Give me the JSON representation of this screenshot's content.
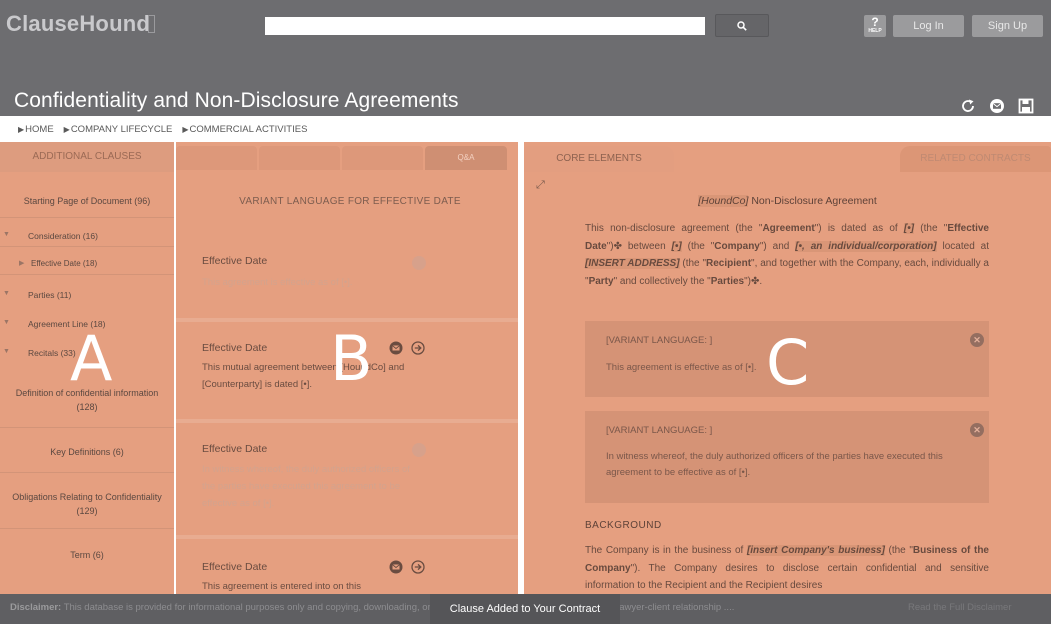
{
  "header": {
    "logo_text": "ClauseHound",
    "search": {
      "placeholder": "",
      "button_icon": "search-icon"
    },
    "help": {
      "mark": "?",
      "label": "HELP"
    },
    "login_label": "Log In",
    "signup_label": "Sign Up",
    "page_title": "Confidentiality and Non-Disclosure Agreements",
    "title_tools": [
      "refresh-icon",
      "email-icon",
      "save-icon"
    ]
  },
  "breadcrumb": [
    "HOME",
    "COMPANY LIFECYCLE",
    "COMMERCIAL ACTIVITIES"
  ],
  "panel_a": {
    "header": "ADDITIONAL CLAUSES",
    "items": [
      {
        "label": "Starting Page of Document (96)"
      },
      {
        "label": "Consideration (16)"
      },
      {
        "label": "Effective Date (18)"
      },
      {
        "label": "Parties (11)"
      },
      {
        "label": "Agreement Line (18)"
      },
      {
        "label": "Recitals (33)"
      },
      {
        "label": "Definition of confidential information (128)"
      },
      {
        "label": "Key Definitions (6)"
      },
      {
        "label": "Obligations Relating to Confidentiality (129)"
      },
      {
        "label": "Term (6)"
      }
    ],
    "overlay_letter": "A"
  },
  "panel_b": {
    "tabs": [
      "",
      "",
      "",
      "Q&A"
    ],
    "heading": "VARIANT LANGUAGE FOR EFFECTIVE DATE",
    "variants": [
      {
        "title": "Effective Date",
        "text": "This agreement is effective as of [•]."
      },
      {
        "title": "Effective Date",
        "text": "This mutual agreement between [HoundCo] and [Counterparty] is dated [•]."
      },
      {
        "title": "Effective Date",
        "text": "In witness whereof, the duly authorized officers of the parties have executed this agreement to be effective as of [•]."
      },
      {
        "title": "Effective Date",
        "text": "This agreement is entered into on this"
      }
    ],
    "overlay_letter": "B"
  },
  "panel_c": {
    "tab_core": "CORE ELEMENTS",
    "tab_related": "RELATED CONTRACTS",
    "doc_title_placeholder": "[HoundCo]",
    "doc_title_rest": " Non-Disclosure Agreement",
    "intro_paragraph": {
      "p1": "This non-disclosure agreement (the \"",
      "agreement": "Agreement",
      "p2": "\") is dated as of ",
      "date_ph": "[•]",
      "p3": " (the \"",
      "effective": "Effective Date",
      "p4": "\")✤ between ",
      "company_ph": "[•]",
      "p5": " (the \"",
      "company": "Company",
      "p6": "\") and ",
      "recipient_ph": "[•, an individual/corporation]",
      "p7": " located at ",
      "address_ph": "[INSERT ADDRESS]",
      "p8": " (the \"",
      "recipient": "Recipient",
      "p9": "\", and together with the Company, each, individually a \"",
      "party": "Party",
      "p10": "\" and collectively the \"",
      "parties": "Parties",
      "p11": "\")✤."
    },
    "variant_boxes": [
      {
        "label": "[VARIANT LANGUAGE: ]",
        "text": "This agreement is effective as of [•]."
      },
      {
        "label": "[VARIANT LANGUAGE: ]",
        "text": "In witness whereof, the duly authorized officers of the parties have executed this agreement to be effective as of [•]."
      }
    ],
    "background_heading": "BACKGROUND",
    "background_paragraph": {
      "p1": "The Company is in the business of ",
      "business_ph": "[insert Company's business]",
      "p2": " (the \"",
      "business": "Business of the Company",
      "p3": "\"). The Company desires to disclose certain confidential and sensitive information to the Recipient and the Recipient desires"
    },
    "overlay_letter": "C"
  },
  "footer": {
    "disclaimer_label": "Disclaimer:",
    "disclaimer_text": " This database is provided for informational purposes only and copying, downloading, or using this site in any way does not create a lawyer-client relationship ....",
    "disclaimer_link": "Read the Full Disclaimer",
    "toast": "Clause Added to Your Contract"
  },
  "colors": {
    "header_bg": "#6d6d70",
    "panel_overlay": "#e59f80",
    "footer_bg": "#5f5f62"
  }
}
